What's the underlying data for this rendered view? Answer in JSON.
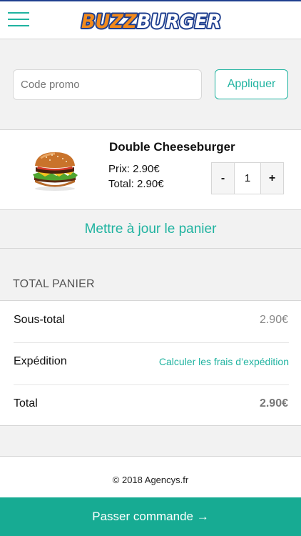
{
  "header": {
    "logo_text": "BUZZBURGER",
    "menu_icon": "hamburger-menu-icon"
  },
  "promo": {
    "placeholder": "Code promo",
    "value": "",
    "apply_label": "Appliquer"
  },
  "cart_items": [
    {
      "image": "burger-image",
      "name": "Double Cheeseburger",
      "price": "Prix: 2.90€",
      "total": "Total: 2.90€",
      "quantity": "1",
      "minus_label": "-",
      "plus_label": "+"
    }
  ],
  "update_cart_label": "Mettre à jour le panier",
  "totals": {
    "heading": "TOTAL PANIER",
    "rows": [
      {
        "label": "Sous-total",
        "value": "2.90€"
      },
      {
        "label": "Expédition",
        "value": "Calculer les frais d’expédition"
      },
      {
        "label": "Total",
        "value": "2.90€"
      }
    ]
  },
  "footer": {
    "copyright": "© 2018 Agencys.fr"
  },
  "checkout_label": "Passer commande →",
  "colors": {
    "accent": "#20b3a0",
    "checkout_bg": "#17ab93",
    "logo_orange": "#f28a1c",
    "logo_blue": "#1f3f8f"
  }
}
